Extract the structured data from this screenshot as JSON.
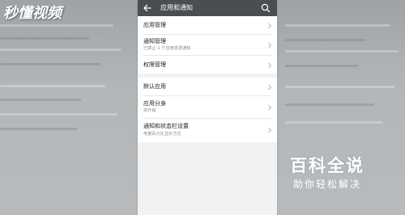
{
  "watermark_top": "秒懂视频",
  "watermark_bottom": {
    "title": "百科全说",
    "subtitle": "助你轻松解决"
  },
  "appbar": {
    "title": "应用和通知",
    "back_icon": "arrow-left-icon",
    "search_icon": "search-icon"
  },
  "settings": {
    "group1": [
      {
        "title": "应用管理",
        "subtitle": ""
      },
      {
        "title": "通知管理",
        "subtitle": "已禁止 1 个应用发送通知"
      },
      {
        "title": "权限管理",
        "subtitle": ""
      }
    ],
    "group2": [
      {
        "title": "默认应用",
        "subtitle": ""
      },
      {
        "title": "应用分身",
        "subtitle": "未开启"
      },
      {
        "title": "通知和状态栏设置",
        "subtitle": "电量百分比显示方式"
      }
    ]
  },
  "colors": {
    "appbar": "#4a4d51",
    "background": "#f2f2f2",
    "text_primary": "#222222",
    "text_secondary": "#8a8a8a"
  }
}
